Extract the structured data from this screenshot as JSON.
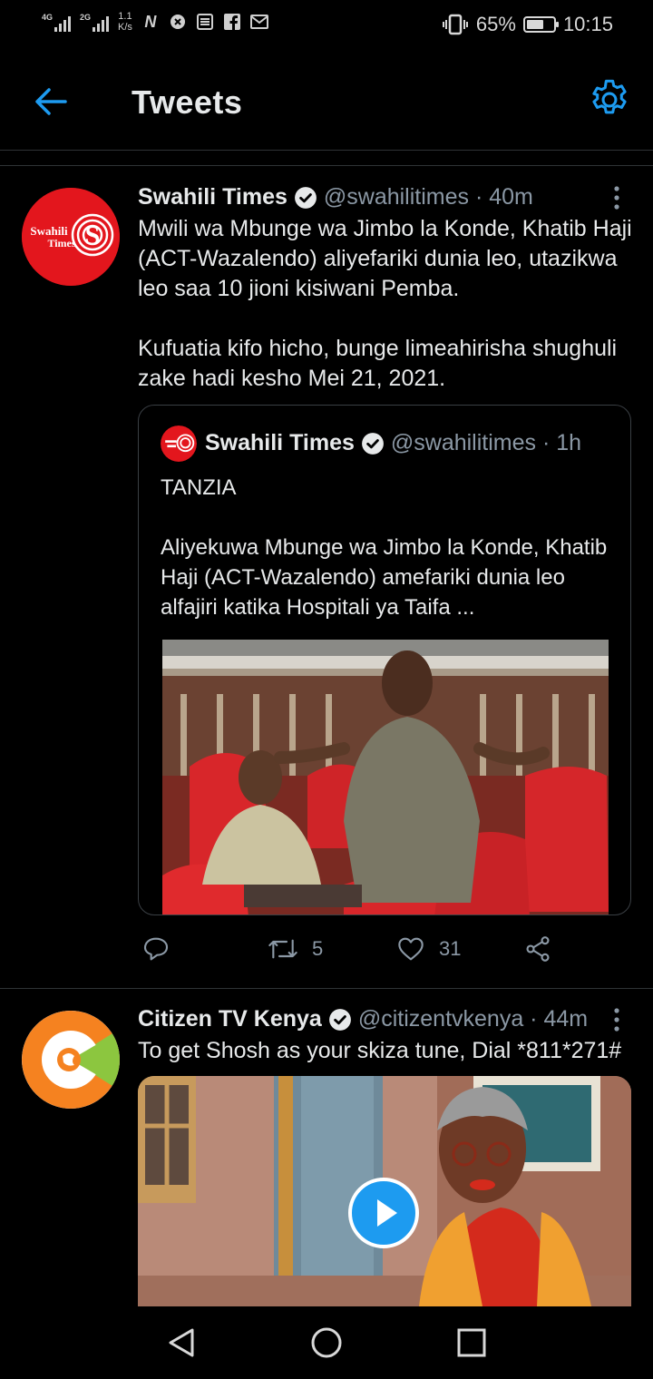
{
  "status_bar": {
    "net1": "4G",
    "net2": "2G",
    "speed_value": "1.1",
    "speed_unit": "K/s",
    "icons": [
      "n-icon",
      "block-icon",
      "news-icon",
      "facebook-icon",
      "gmail-icon"
    ],
    "battery_percent": "65%",
    "battery_level": 0.65,
    "time": "10:15"
  },
  "header": {
    "title": "Tweets"
  },
  "tweets": [
    {
      "name": "Swahili Times",
      "handle_time": "@swahilitimes · 40m",
      "avatar_text_1": "Swahili",
      "avatar_text_2": "Times",
      "text": "Mwili wa Mbunge wa Jimbo la Konde, Khatib Haji (ACT-Wazalendo) aliyefariki dunia leo, utazikwa leo saa 10 jioni kisiwani Pemba.\n\nKufuatia kifo hicho, bunge limeahirisha shughuli zake hadi kesho Mei 21, 2021.",
      "quote": {
        "name": "Swahili Times",
        "handle_time": "@swahilitimes · 1h",
        "text": "TANZIA\n\nAliyekuwa Mbunge wa Jimbo la Konde, Khatib Haji (ACT-Wazalendo) amefariki dunia leo alfajiri katika Hospitali ya Taifa ..."
      },
      "retweets": "5",
      "likes": "31"
    },
    {
      "name": "Citizen TV Kenya",
      "handle_time": "@citizentvkenya · 44m",
      "text": "To get Shosh as your skiza tune, Dial *811*271#"
    }
  ],
  "colors": {
    "accent": "#1d9bf0",
    "background": "#000000",
    "swahili_red": "#e3161d",
    "citizen_orange": "#f58220",
    "citizen_green": "#8cc63f"
  }
}
